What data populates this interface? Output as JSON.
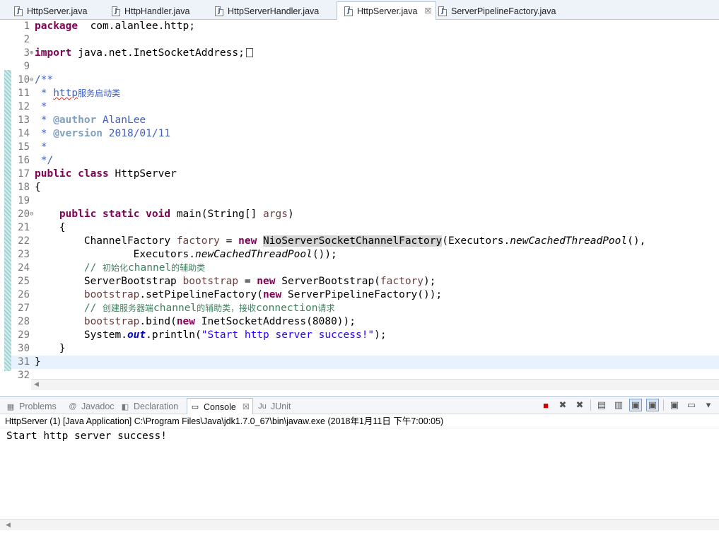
{
  "editor_tabs": [
    {
      "label": "HttpServer.java",
      "active": false
    },
    {
      "label": "HttpHandler.java",
      "active": false
    },
    {
      "label": "HttpServerHandler.java",
      "active": false
    },
    {
      "label": "HttpServer.java",
      "active": true
    },
    {
      "label": "ServerPipelineFactory.java",
      "active": false
    }
  ],
  "tab_close_glyph": "☒",
  "code_lines": [
    {
      "n": "1",
      "t": [
        [
          "kw",
          "package"
        ],
        [
          "",
          "  com.alanlee.http;"
        ]
      ]
    },
    {
      "n": "2",
      "t": []
    },
    {
      "n": "3",
      "fold": "+",
      "t": [
        [
          "kw",
          "import"
        ],
        [
          "",
          " java.net.InetSocketAddress;"
        ],
        [
          "box",
          ""
        ]
      ]
    },
    {
      "n": "9",
      "t": []
    },
    {
      "n": "10",
      "fold": "−",
      "t": [
        [
          "jd",
          "/**"
        ]
      ]
    },
    {
      "n": "11",
      "t": [
        [
          "jd",
          " * "
        ],
        [
          "jdsq",
          "http"
        ],
        [
          "jdcjk",
          "服务启动类"
        ]
      ]
    },
    {
      "n": "12",
      "t": [
        [
          "jd",
          " *"
        ]
      ]
    },
    {
      "n": "13",
      "t": [
        [
          "jd",
          " * "
        ],
        [
          "tag",
          "@author"
        ],
        [
          "jd",
          " AlanLee"
        ]
      ]
    },
    {
      "n": "14",
      "t": [
        [
          "jd",
          " * "
        ],
        [
          "tag",
          "@version"
        ],
        [
          "jd",
          " 2018/01/11"
        ]
      ]
    },
    {
      "n": "15",
      "t": [
        [
          "jd",
          " *"
        ]
      ]
    },
    {
      "n": "16",
      "t": [
        [
          "jd",
          " */"
        ]
      ]
    },
    {
      "n": "17",
      "t": [
        [
          "kw",
          "public"
        ],
        [
          "",
          " "
        ],
        [
          "kw",
          "class"
        ],
        [
          "",
          " HttpServer"
        ]
      ]
    },
    {
      "n": "18",
      "t": [
        [
          "",
          "{"
        ]
      ]
    },
    {
      "n": "19",
      "t": []
    },
    {
      "n": "20",
      "fold": "−",
      "t": [
        [
          "",
          "    "
        ],
        [
          "kw",
          "public"
        ],
        [
          "",
          " "
        ],
        [
          "kw",
          "static"
        ],
        [
          "",
          " "
        ],
        [
          "kw",
          "void"
        ],
        [
          "",
          " main(String[] "
        ],
        [
          "var",
          "args"
        ],
        [
          "",
          ")"
        ]
      ]
    },
    {
      "n": "21",
      "t": [
        [
          "",
          "    {"
        ]
      ]
    },
    {
      "n": "22",
      "t": [
        [
          "",
          "        ChannelFactory "
        ],
        [
          "var",
          "factory"
        ],
        [
          "",
          " = "
        ],
        [
          "kw",
          "new"
        ],
        [
          "",
          " "
        ],
        [
          "hl",
          "NioServerSocketChannelFactory"
        ],
        [
          "",
          "(Executors."
        ],
        [
          "italic",
          "newCachedThreadPool"
        ],
        [
          "",
          "(),"
        ]
      ]
    },
    {
      "n": "23",
      "t": [
        [
          "",
          "                Executors."
        ],
        [
          "italic",
          "newCachedThreadPool"
        ],
        [
          "",
          "());"
        ]
      ]
    },
    {
      "n": "24",
      "t": [
        [
          "cm",
          "        // "
        ],
        [
          "cmcjk",
          "初始化"
        ],
        [
          "cm",
          "channel"
        ],
        [
          "cmcjk",
          "的辅助类"
        ]
      ]
    },
    {
      "n": "25",
      "t": [
        [
          "",
          "        ServerBootstrap "
        ],
        [
          "var",
          "bootstrap"
        ],
        [
          "",
          " = "
        ],
        [
          "kw",
          "new"
        ],
        [
          "",
          " ServerBootstrap("
        ],
        [
          "var",
          "factory"
        ],
        [
          "",
          ");"
        ]
      ]
    },
    {
      "n": "26",
      "t": [
        [
          "",
          "        "
        ],
        [
          "var",
          "bootstrap"
        ],
        [
          "",
          ".setPipelineFactory("
        ],
        [
          "kw",
          "new"
        ],
        [
          "",
          " ServerPipelineFactory());"
        ]
      ]
    },
    {
      "n": "27",
      "t": [
        [
          "cm",
          "        // "
        ],
        [
          "cmcjk",
          "创建服务器端"
        ],
        [
          "cm",
          "channel"
        ],
        [
          "cmcjk",
          "的辅助类，接收"
        ],
        [
          "cm",
          "connection"
        ],
        [
          "cmcjk",
          "请求"
        ]
      ]
    },
    {
      "n": "28",
      "t": [
        [
          "",
          "        "
        ],
        [
          "var",
          "bootstrap"
        ],
        [
          "",
          ".bind("
        ],
        [
          "kw",
          "new"
        ],
        [
          "",
          " InetSocketAddress(8080));"
        ]
      ]
    },
    {
      "n": "29",
      "t": [
        [
          "",
          "        System."
        ],
        [
          "static",
          "out"
        ],
        [
          "",
          ".println("
        ],
        [
          "str",
          "\"Start http server success!\""
        ],
        [
          "",
          ");"
        ]
      ]
    },
    {
      "n": "30",
      "t": [
        [
          "",
          "    }"
        ]
      ]
    },
    {
      "n": "31",
      "t": [
        [
          "",
          "}"
        ]
      ],
      "current": true
    },
    {
      "n": "32",
      "t": []
    }
  ],
  "view_tabs": [
    {
      "label": "Problems",
      "icon": "▦",
      "icon_name": "problems-icon",
      "active": false
    },
    {
      "label": "Javadoc",
      "icon": "@",
      "icon_name": "javadoc-icon",
      "active": false
    },
    {
      "label": "Declaration",
      "icon": "◧",
      "icon_name": "declaration-icon",
      "active": false
    },
    {
      "label": "Console",
      "icon": "▭",
      "icon_name": "console-icon",
      "active": true
    },
    {
      "label": "JUnit",
      "icon": "Ju",
      "icon_name": "junit-icon",
      "active": false
    }
  ],
  "console_toolbar": [
    {
      "glyph": "■",
      "name": "terminate-icon",
      "red": true
    },
    {
      "glyph": "✖",
      "name": "remove-launch-icon"
    },
    {
      "glyph": "✖",
      "name": "remove-all-terminated-icon"
    },
    {
      "sep": true
    },
    {
      "glyph": "▤",
      "name": "clear-console-icon"
    },
    {
      "glyph": "▥",
      "name": "scroll-lock-icon"
    },
    {
      "glyph": "▣",
      "name": "show-on-stdout-icon",
      "pressed": true
    },
    {
      "glyph": "▣",
      "name": "show-on-stderr-icon",
      "pressed": true
    },
    {
      "sep": true
    },
    {
      "glyph": "▣",
      "name": "pin-console-icon"
    },
    {
      "glyph": "▭",
      "name": "display-console-icon"
    },
    {
      "glyph": "▾",
      "name": "view-menu-icon"
    }
  ],
  "console": {
    "header": "HttpServer (1) [Java Application] C:\\Program Files\\Java\\jdk1.7.0_67\\bin\\javaw.exe (2018年1月11日 下午7:00:05)",
    "output": "Start http server success!"
  }
}
